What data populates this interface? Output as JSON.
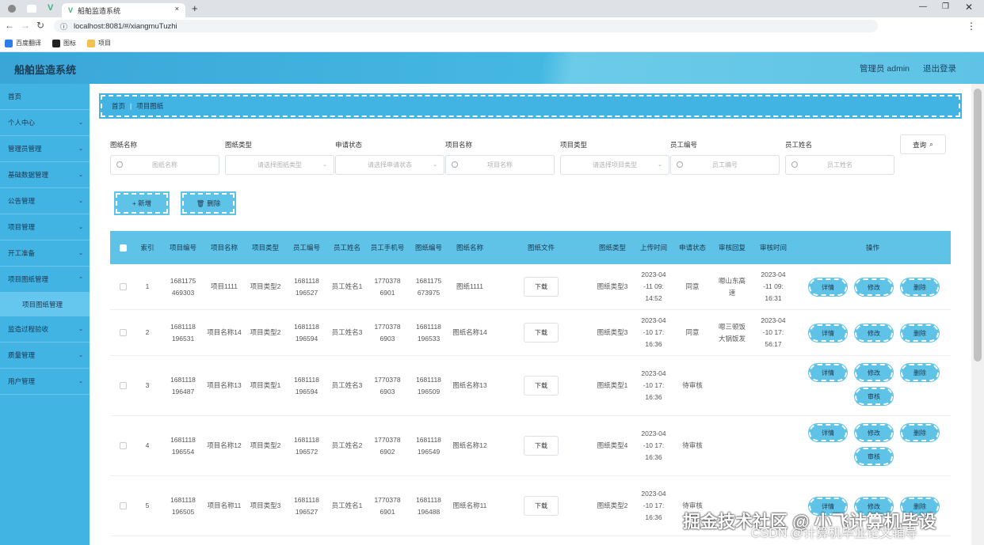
{
  "browser": {
    "tab_title": "船舶监造系统",
    "url": "localhost:8081/#/xiangmuTuzhi",
    "bookmarks": [
      "百度翻译",
      "图标",
      "项目"
    ]
  },
  "header": {
    "title": "船舶监造系统",
    "user": "管理员 admin",
    "logout": "退出登录"
  },
  "sidebar": {
    "items": [
      "首页",
      "个人中心",
      "管理员管理",
      "基础数据管理",
      "公告管理",
      "项目管理",
      "开工准备",
      "项目图纸管理"
    ],
    "sub_item": "项目图纸管理",
    "items_after": [
      "监造过程验收",
      "质量管理",
      "用户管理"
    ]
  },
  "breadcrumb": {
    "home": "首页",
    "current": "项目图纸"
  },
  "filters": [
    {
      "label": "图纸名称",
      "placeholder": "图纸名称",
      "type": "input"
    },
    {
      "label": "图纸类型",
      "placeholder": "请选择图纸类型",
      "type": "select"
    },
    {
      "label": "申请状态",
      "placeholder": "请选择申请状态",
      "type": "select"
    },
    {
      "label": "项目名称",
      "placeholder": "项目名称",
      "type": "input"
    },
    {
      "label": "项目类型",
      "placeholder": "请选择项目类型",
      "type": "select"
    },
    {
      "label": "员工编号",
      "placeholder": "员工编号",
      "type": "input"
    },
    {
      "label": "员工姓名",
      "placeholder": "员工姓名",
      "type": "input"
    }
  ],
  "query_label": "查询",
  "actions": {
    "add": "+ 新增",
    "delete": "删除"
  },
  "table": {
    "headers": [
      "索引",
      "项目编号",
      "项目名称",
      "项目类型",
      "员工编号",
      "员工姓名",
      "员工手机号",
      "图纸编号",
      "图纸名称",
      "图纸文件",
      "图纸类型",
      "上传时间",
      "申请状态",
      "审核回复",
      "审核时间",
      "操作"
    ],
    "download_label": "下载",
    "op_labels": {
      "detail": "详情",
      "edit": "修改",
      "delete": "删除",
      "review": "审核"
    },
    "rows": [
      {
        "index": "1",
        "proj_no": "1681175469303",
        "proj_name": "项目1111",
        "proj_type": "项目类型2",
        "emp_no": "1681118196527",
        "emp_name": "员工姓名1",
        "phone": "17703786901",
        "drawing_no": "1681175673975",
        "drawing_name": "图纸1111",
        "drawing_type": "图纸类型3",
        "upload_time": "2023-04-11 09:14:52",
        "status": "同意",
        "reply": "嗯山东高速",
        "review_time": "2023-04-11 09:16:31",
        "review_btn": false
      },
      {
        "index": "2",
        "proj_no": "1681118196531",
        "proj_name": "项目名称14",
        "proj_type": "项目类型2",
        "emp_no": "1681118196594",
        "emp_name": "员工姓名3",
        "phone": "17703786903",
        "drawing_no": "1681118196533",
        "drawing_name": "图纸名称14",
        "drawing_type": "图纸类型3",
        "upload_time": "2023-04-10 17:16:36",
        "status": "同意",
        "reply": "嗯三顿饭大锅饭发",
        "review_time": "2023-04-10 17:56:17",
        "review_btn": false
      },
      {
        "index": "3",
        "proj_no": "1681118196487",
        "proj_name": "项目名称13",
        "proj_type": "项目类型1",
        "emp_no": "1681118196594",
        "emp_name": "员工姓名3",
        "phone": "17703786903",
        "drawing_no": "1681118196509",
        "drawing_name": "图纸名称13",
        "drawing_type": "图纸类型1",
        "upload_time": "2023-04-10 17:16:36",
        "status": "待审核",
        "reply": "",
        "review_time": "",
        "review_btn": true
      },
      {
        "index": "4",
        "proj_no": "1681118196554",
        "proj_name": "项目名称12",
        "proj_type": "项目类型2",
        "emp_no": "1681118196572",
        "emp_name": "员工姓名2",
        "phone": "17703786902",
        "drawing_no": "1681118196549",
        "drawing_name": "图纸名称12",
        "drawing_type": "图纸类型4",
        "upload_time": "2023-04-10 17:16:36",
        "status": "待审核",
        "reply": "",
        "review_time": "",
        "review_btn": true
      },
      {
        "index": "5",
        "proj_no": "1681118196505",
        "proj_name": "项目名称11",
        "proj_type": "项目类型3",
        "emp_no": "1681118196527",
        "emp_name": "员工姓名1",
        "phone": "17703786901",
        "drawing_no": "1681118196488",
        "drawing_name": "图纸名称11",
        "drawing_type": "图纸类型2",
        "upload_time": "2023-04-10 17:16:36",
        "status": "待审核",
        "reply": "",
        "review_time": "",
        "review_btn": false
      }
    ]
  },
  "watermark": {
    "line1": "掘金技术社区 @ 小飞计算机毕设",
    "line2": "CSDN @计算机毕业论文辅导"
  }
}
